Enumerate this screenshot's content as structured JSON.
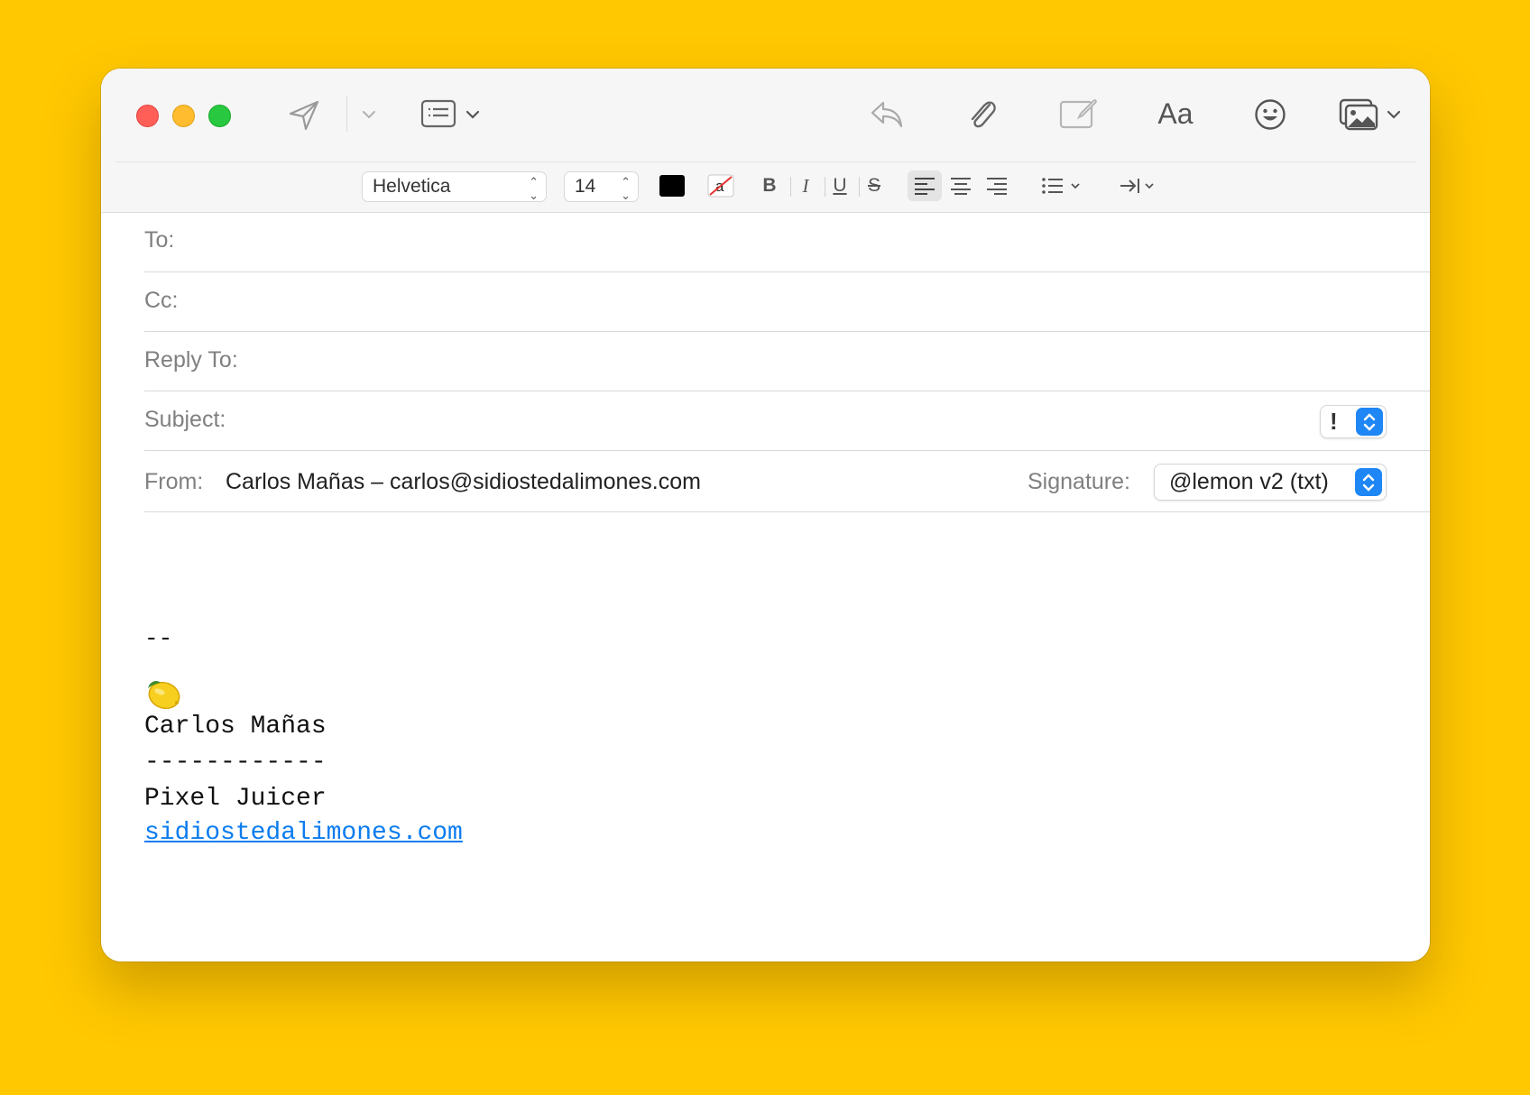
{
  "toolbar": {
    "icons": [
      "send-icon",
      "send-later-chevron-icon",
      "header-fields-icon",
      "reply-icon",
      "attachment-icon",
      "markup-icon",
      "format-icon",
      "emoji-icon",
      "photo-browser-icon"
    ],
    "format_label": "Aa"
  },
  "format_bar": {
    "font": "Helvetica",
    "size": "14",
    "text_color": "#000000",
    "bold": "B",
    "italic": "I",
    "underline": "U",
    "strikethrough": "S",
    "active_alignment": "left"
  },
  "headers": {
    "to_label": "To:",
    "cc_label": "Cc:",
    "reply_to_label": "Reply To:",
    "subject_label": "Subject:",
    "priority_value": "!",
    "from_label": "From:",
    "from_value": "Carlos Mañas – carlos@sidiostedalimones.com",
    "signature_label": "Signature:",
    "signature_value": "@lemon v2 (txt)"
  },
  "signature": {
    "separator": "--",
    "emoji": "lemon-icon",
    "name": "Carlos Mañas",
    "underline": "------------",
    "title": "Pixel Juicer",
    "link": "sidiostedalimones.com"
  },
  "colors": {
    "background": "#FFC800",
    "accent": "#1E86F5",
    "link": "#0B7CEF"
  }
}
